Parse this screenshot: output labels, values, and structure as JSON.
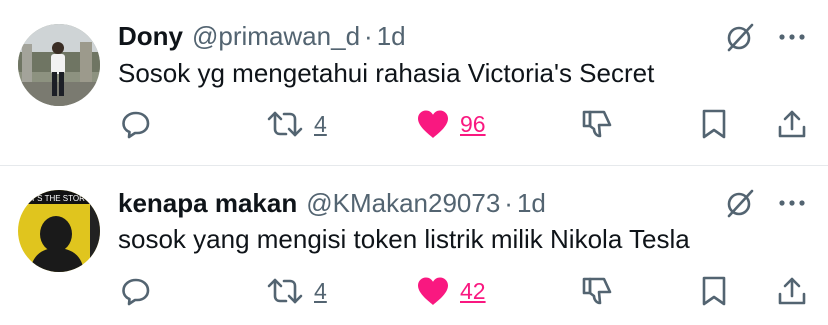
{
  "tweets": [
    {
      "name": "Dony",
      "handle": "@primawan_d",
      "separator": "·",
      "time": "1d",
      "text": "Sosok yg mengetahui rahasia Victoria's Secret",
      "retweets": "4",
      "likes": "96",
      "liked": true,
      "avatar": "photo of a person standing in front of a building"
    },
    {
      "name": "kenapa makan",
      "handle": "@KMakan29073",
      "separator": "·",
      "time": "1d",
      "text": "sosok yang mengisi token listrik milik Nikola Tesla",
      "retweets": "4",
      "likes": "42",
      "liked": true,
      "avatar": "yellow album-style cover with a dark silhouette",
      "avatar_text": "AT'S THE STORY"
    }
  ],
  "colors": {
    "like": "#f91880",
    "icon": "#536471",
    "text": "#0f1419",
    "divider": "#e6e9ec"
  },
  "icons": [
    "grok-icon",
    "more-icon",
    "reply-icon",
    "retweet-icon",
    "heart-icon",
    "dislike-icon",
    "bookmark-icon",
    "share-icon"
  ]
}
